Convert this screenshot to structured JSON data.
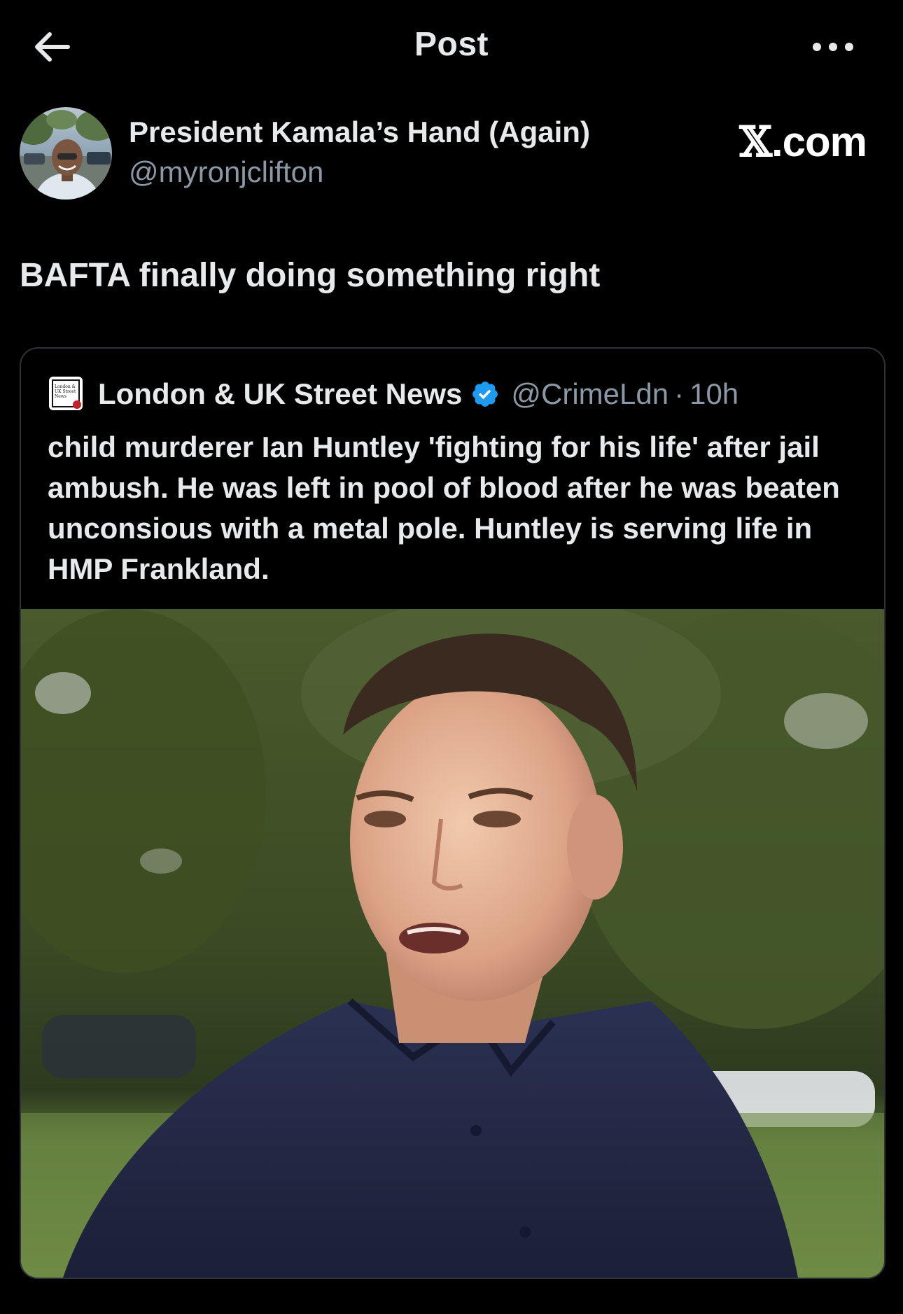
{
  "header": {
    "title": "Post"
  },
  "post": {
    "author_name": "President Kamala’s Hand (Again)",
    "author_handle": "@myronjclifton",
    "text": "BAFTA finally doing something right"
  },
  "watermark": {
    "x_glyph": "𝕏",
    "suffix": ".com"
  },
  "quote": {
    "author_name": "London & UK Street News",
    "author_handle": "@CrimeLdn",
    "separator": "·",
    "time": "10h",
    "text": "child murderer Ian Huntley 'fighting for his life' after jail ambush. He was left in pool of blood after he was beaten unconsious with a metal pole. Huntley is serving life in HMP Frankland.",
    "logo_text": [
      "London &",
      "UK Street",
      "News"
    ]
  },
  "icons": {
    "back": "arrow-left-icon",
    "more": "more-horizontal-icon",
    "verified": "verified-badge-icon"
  },
  "colors": {
    "background": "#000000",
    "text_primary": "#e7e9ea",
    "text_secondary": "#8b98a5",
    "border": "#2f3336",
    "verified_blue": "#1d9bf0"
  }
}
